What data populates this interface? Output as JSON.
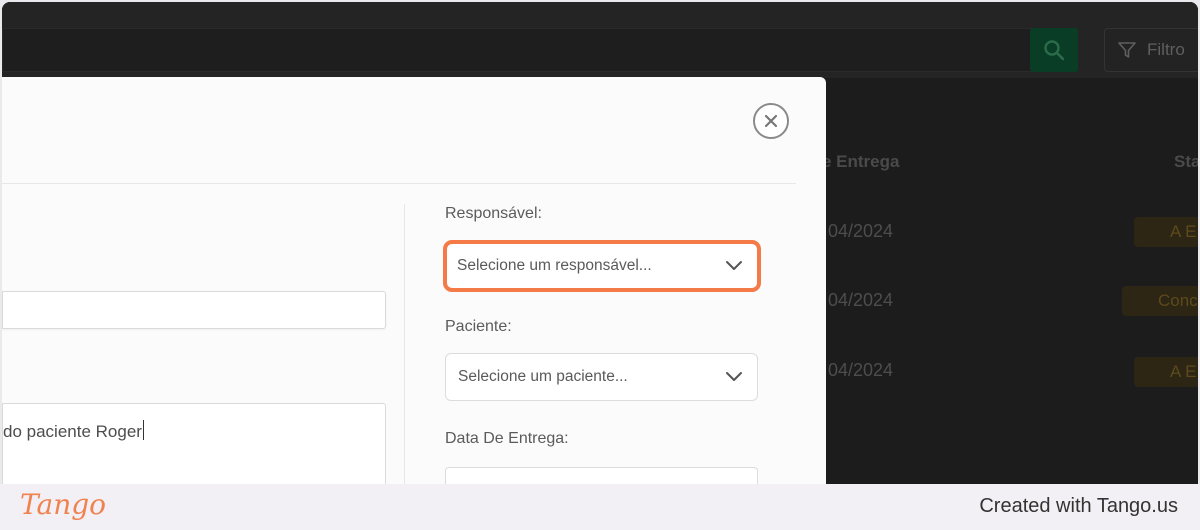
{
  "background": {
    "filter_label": "Filtro",
    "columns": [
      "e Entrega",
      "Sta"
    ],
    "rows": [
      {
        "date": "04/2024",
        "status": "A E"
      },
      {
        "date": "04/2024",
        "status": "Conc"
      },
      {
        "date": "04/2024",
        "status": "A E"
      }
    ]
  },
  "modal": {
    "description_value": "do paciente Roger",
    "responsavel": {
      "label": "Responsável:",
      "placeholder": "Selecione um responsável..."
    },
    "paciente": {
      "label": "Paciente:",
      "placeholder": "Selecione um paciente..."
    },
    "data_entrega": {
      "label": "Data De Entrega:"
    }
  },
  "footer": {
    "logo": "Tango",
    "credit": "Created with Tango.us"
  },
  "colors": {
    "highlight": "#f47a48",
    "brand": "#f0824f",
    "search_button": "#0a3d25"
  }
}
